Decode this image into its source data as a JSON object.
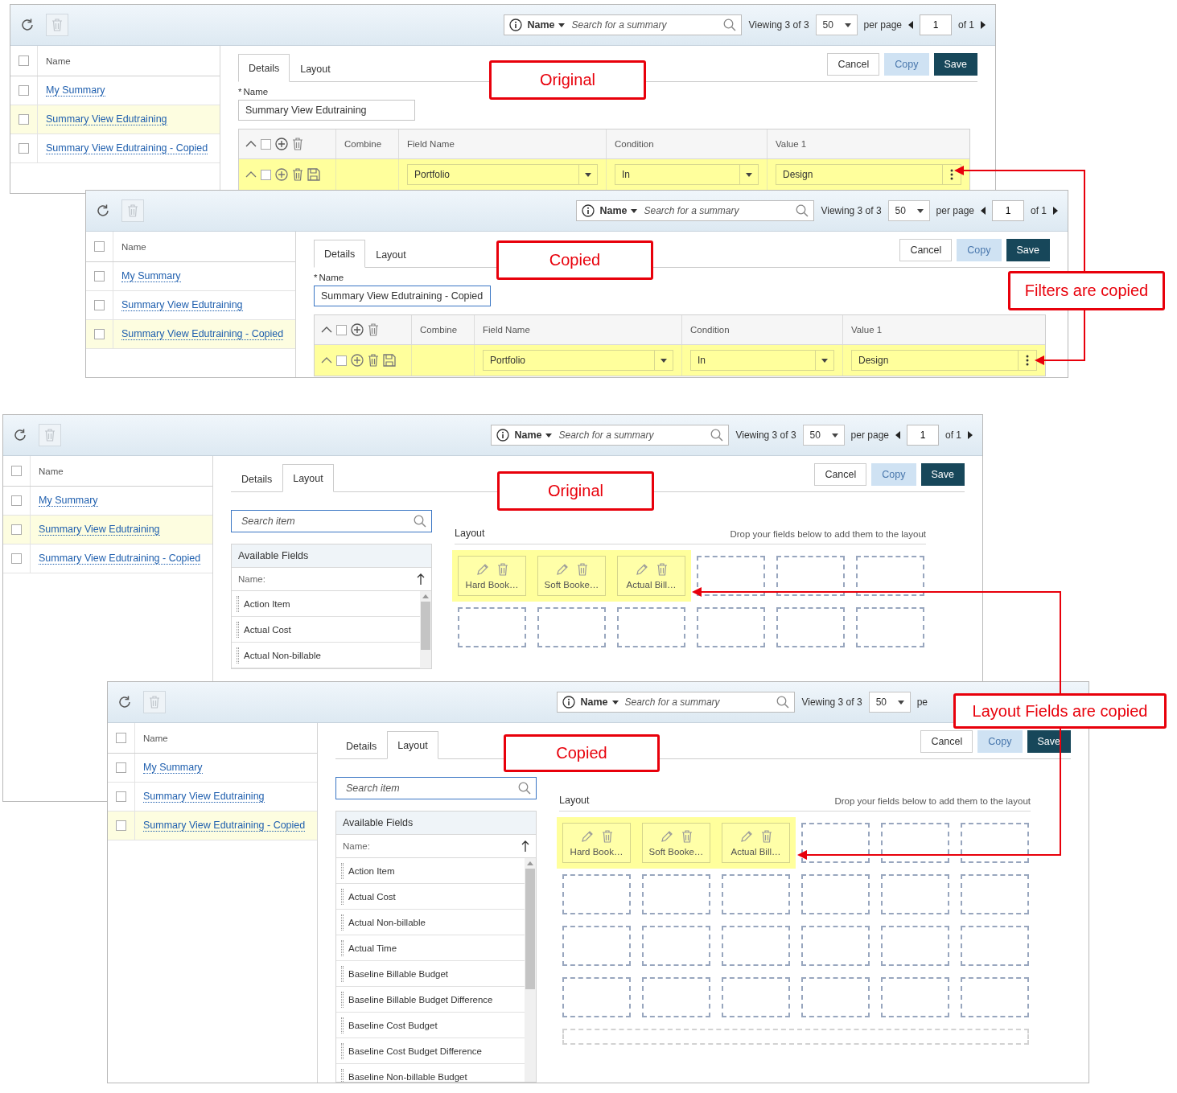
{
  "windows": [
    {
      "delete_disabled": true,
      "toolbar": {
        "scope": "Name",
        "placeholder": "Search for a summary",
        "viewing": "Viewing 3 of 3",
        "page_size": "50",
        "per_page": "per page",
        "page": "1",
        "of_pages": "of 1"
      },
      "list": {
        "header": "Name",
        "all_checked": false,
        "rows": [
          {
            "label": "My Summary",
            "selected": false,
            "checked": false
          },
          {
            "label": "Summary View Edutraining",
            "selected": true,
            "checked": false
          },
          {
            "label": "Summary View Edutraining - Copied",
            "selected": false,
            "checked": false
          }
        ]
      },
      "tabs": [
        {
          "label": "Details",
          "selected": true
        },
        {
          "label": "Layout",
          "selected": false
        }
      ],
      "buttons": [
        {
          "label": "Cancel",
          "kind": "default"
        },
        {
          "label": "Copy",
          "kind": "light"
        },
        {
          "label": "Save",
          "kind": "primary"
        }
      ],
      "panel": {
        "kind": "details",
        "required_mark": "*",
        "name_label": "Name",
        "name_value": "Summary View Edutraining",
        "focused": false,
        "all_checked": false,
        "columns": [
          "Combine",
          "Field Name",
          "Condition",
          "Value 1"
        ],
        "filters": [
          {
            "field": "Portfolio",
            "condition": "In",
            "value": "Design",
            "highlighted": true,
            "checked": false
          }
        ]
      }
    },
    {
      "delete_disabled": true,
      "toolbar": {
        "scope": "Name",
        "placeholder": "Search for a summary",
        "viewing": "Viewing 3 of 3",
        "page_size": "50",
        "per_page": "per page",
        "page": "1",
        "of_pages": "of 1"
      },
      "list": {
        "header": "Name",
        "all_checked": false,
        "rows": [
          {
            "label": "My Summary",
            "selected": false,
            "checked": false
          },
          {
            "label": "Summary View Edutraining",
            "selected": false,
            "checked": false
          },
          {
            "label": "Summary View Edutraining - Copied",
            "selected": true,
            "checked": false
          }
        ]
      },
      "tabs": [
        {
          "label": "Details",
          "selected": true
        },
        {
          "label": "Layout",
          "selected": false
        }
      ],
      "buttons": [
        {
          "label": "Cancel",
          "kind": "default"
        },
        {
          "label": "Copy",
          "kind": "light"
        },
        {
          "label": "Save",
          "kind": "primary"
        }
      ],
      "panel": {
        "kind": "details",
        "required_mark": "*",
        "name_label": "Name",
        "name_value": "Summary View Edutraining - Copied",
        "focused": true,
        "all_checked": false,
        "columns": [
          "Combine",
          "Field Name",
          "Condition",
          "Value 1"
        ],
        "filters": [
          {
            "field": "Portfolio",
            "condition": "In",
            "value": "Design",
            "highlighted": true,
            "checked": false
          }
        ]
      }
    },
    {
      "delete_disabled": true,
      "toolbar": {
        "scope": "Name",
        "placeholder": "Search for a summary",
        "viewing": "Viewing 3 of 3",
        "page_size": "50",
        "per_page": "per page",
        "page": "1",
        "of_pages": "of 1"
      },
      "list": {
        "header": "Name",
        "all_checked": false,
        "rows": [
          {
            "label": "My Summary",
            "selected": false,
            "checked": false
          },
          {
            "label": "Summary View Edutraining",
            "selected": true,
            "checked": false
          },
          {
            "label": "Summary View Edutraining - Copied",
            "selected": false,
            "checked": false
          }
        ]
      },
      "tabs": [
        {
          "label": "Details",
          "selected": false
        },
        {
          "label": "Layout",
          "selected": true
        }
      ],
      "buttons": [
        {
          "label": "Cancel",
          "kind": "default"
        },
        {
          "label": "Copy",
          "kind": "light"
        },
        {
          "label": "Save",
          "kind": "primary"
        }
      ],
      "panel": {
        "kind": "layout",
        "search_placeholder": "Search item",
        "fields_title": "Available Fields",
        "name_label": "Name:",
        "fields": [
          "Action Item",
          "Actual Cost",
          "Actual Non-billable"
        ],
        "layout_title": "Layout",
        "hint": "Drop your fields below to add them to the layout",
        "slots": [
          {
            "kind": "field",
            "label": "Hard Book…",
            "highlighted": true
          },
          {
            "kind": "field",
            "label": "Soft Booke…",
            "highlighted": true
          },
          {
            "kind": "field",
            "label": "Actual Bill…",
            "highlighted": true
          },
          {
            "kind": "empty"
          },
          {
            "kind": "empty"
          },
          {
            "kind": "empty"
          },
          {
            "kind": "empty"
          },
          {
            "kind": "empty"
          },
          {
            "kind": "empty"
          },
          {
            "kind": "empty"
          },
          {
            "kind": "empty"
          },
          {
            "kind": "empty"
          }
        ]
      }
    },
    {
      "delete_disabled": true,
      "toolbar": {
        "scope": "Name",
        "placeholder": "Search for a summary",
        "viewing": "Viewing 3 of 3",
        "page_size": "50",
        "per_page": "pe"
      },
      "list": {
        "header": "Name",
        "all_checked": false,
        "rows": [
          {
            "label": "My Summary",
            "selected": false,
            "checked": false
          },
          {
            "label": "Summary View Edutraining",
            "selected": false,
            "checked": false
          },
          {
            "label": "Summary View Edutraining - Copied",
            "selected": true,
            "checked": false
          }
        ]
      },
      "tabs": [
        {
          "label": "Details",
          "selected": false
        },
        {
          "label": "Layout",
          "selected": true
        }
      ],
      "buttons": [
        {
          "label": "Cancel",
          "kind": "default"
        },
        {
          "label": "Copy",
          "kind": "light"
        },
        {
          "label": "Save",
          "kind": "primary"
        }
      ],
      "panel": {
        "kind": "layout",
        "search_placeholder": "Search item",
        "fields_title": "Available Fields",
        "name_label": "Name:",
        "fields": [
          "Action Item",
          "Actual Cost",
          "Actual Non-billable",
          "Actual Time",
          "Baseline Billable Budget",
          "Baseline Billable Budget Difference",
          "Baseline Cost Budget",
          "Baseline Cost Budget Difference",
          "Baseline Non-billable Budget"
        ],
        "layout_title": "Layout",
        "hint": "Drop your fields below to add them to the layout",
        "slots": [
          {
            "kind": "field",
            "label": "Hard Book…",
            "highlighted": true
          },
          {
            "kind": "field",
            "label": "Soft Booke…",
            "highlighted": true
          },
          {
            "kind": "field",
            "label": "Actual Bill…",
            "highlighted": true
          },
          {
            "kind": "empty"
          },
          {
            "kind": "empty"
          },
          {
            "kind": "empty"
          },
          {
            "kind": "empty"
          },
          {
            "kind": "empty"
          },
          {
            "kind": "empty"
          },
          {
            "kind": "empty"
          },
          {
            "kind": "empty"
          },
          {
            "kind": "empty"
          },
          {
            "kind": "empty"
          },
          {
            "kind": "empty"
          },
          {
            "kind": "empty"
          },
          {
            "kind": "empty"
          },
          {
            "kind": "empty"
          },
          {
            "kind": "empty"
          },
          {
            "kind": "empty"
          },
          {
            "kind": "empty"
          },
          {
            "kind": "empty"
          },
          {
            "kind": "empty"
          },
          {
            "kind": "empty"
          },
          {
            "kind": "empty"
          },
          {
            "kind": "wide"
          }
        ]
      }
    }
  ],
  "callouts": [
    {
      "text": "Original"
    },
    {
      "text": "Copied"
    },
    {
      "text": "Filters are copied"
    },
    {
      "text": "Original"
    },
    {
      "text": "Copied"
    },
    {
      "text": "Layout Fields are copied"
    }
  ]
}
